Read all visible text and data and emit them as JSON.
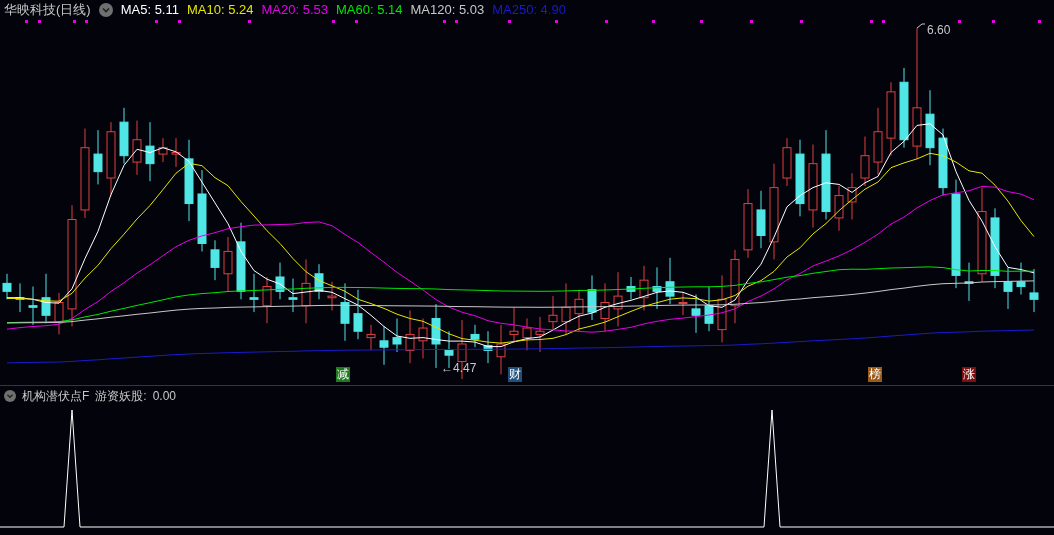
{
  "title": "华映科技(日线)",
  "legend": [
    {
      "label": "MA5:",
      "value": "5.11",
      "color": "#ffffff"
    },
    {
      "label": "MA10:",
      "value": "5.24",
      "color": "#e6e600"
    },
    {
      "label": "MA20:",
      "value": "5.53",
      "color": "#e600e6"
    },
    {
      "label": "MA60:",
      "value": "5.14",
      "color": "#00e600"
    },
    {
      "label": "MA120:",
      "value": "5.03",
      "color": "#c8c8c8"
    },
    {
      "label": "MA250:",
      "value": "4.90",
      "color": "#1a1acc"
    }
  ],
  "annotations": [
    {
      "kind": "high",
      "text": "6.60"
    },
    {
      "kind": "low",
      "text": "←4.47"
    }
  ],
  "markers": [
    {
      "text": "减",
      "color": "#1f7a1f"
    },
    {
      "text": "财",
      "color": "#1f4f7a"
    },
    {
      "text": "榜",
      "color": "#9a5a1a"
    },
    {
      "text": "涨",
      "color": "#7a1010"
    }
  ],
  "indicator": {
    "name": "机构潜伏点F",
    "label": "游资妖股:",
    "value": "0.00"
  }
}
